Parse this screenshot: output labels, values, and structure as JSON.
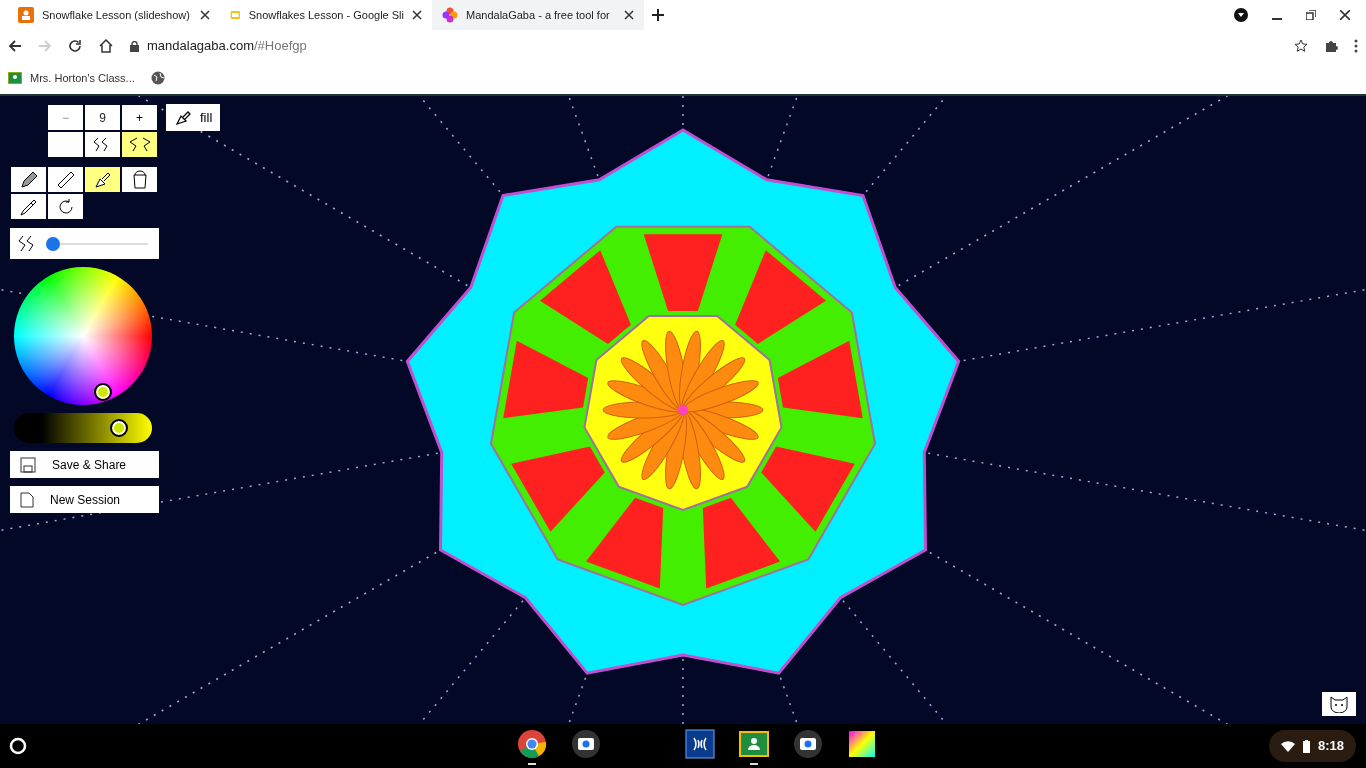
{
  "tabs": [
    {
      "title": "Snowflake Lesson (slideshow)",
      "selected": false
    },
    {
      "title": "Snowflakes Lesson - Google Sli",
      "selected": false
    },
    {
      "title": "MandalaGaba - a free tool for",
      "selected": true
    }
  ],
  "address": {
    "host": "mandalagaba.com",
    "path": "/#Hoefgp"
  },
  "bookmarks": [
    {
      "label": "Mrs. Horton's Class..."
    }
  ],
  "toolbar": {
    "minus": "−",
    "count": "9",
    "plus": "+",
    "fill_label": "fill",
    "symmetry_modes": [
      {
        "selected": false
      },
      {
        "selected": false
      },
      {
        "selected": true
      }
    ],
    "tools": [
      {
        "selected": false
      },
      {
        "selected": false
      },
      {
        "selected": true
      },
      {
        "selected": false
      },
      {
        "selected": false
      },
      {
        "selected": false
      }
    ],
    "brush_size": {
      "level": 0.05
    },
    "brightness": {
      "level": 0.83
    },
    "buttons": [
      {
        "label": "Save & Share"
      },
      {
        "label": "New Session"
      }
    ]
  },
  "taskbar": {
    "apps": [
      {
        "running": true
      },
      {
        "running": false
      },
      {
        "running": false
      },
      {
        "running": true
      },
      {
        "running": false
      },
      {
        "running": false
      }
    ],
    "clock": "8:18"
  }
}
